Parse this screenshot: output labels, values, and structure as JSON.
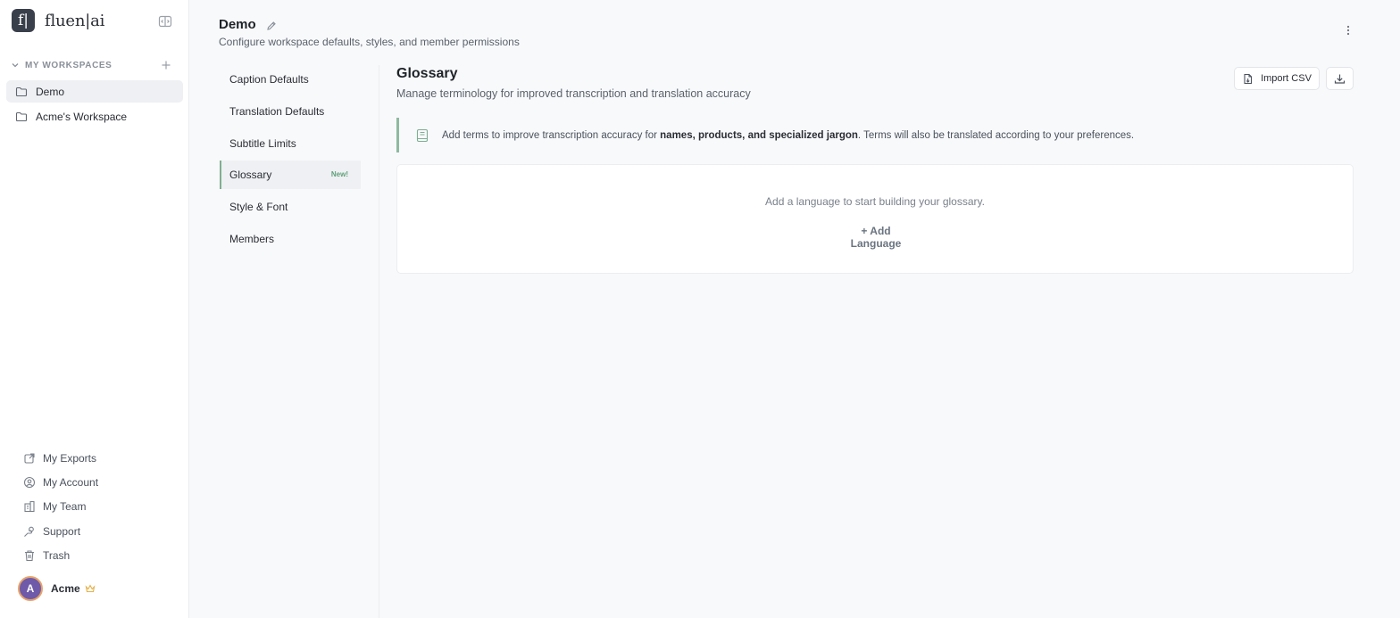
{
  "app": {
    "logo_letter": "f|",
    "logo_text": "fluen|ai"
  },
  "sidebar": {
    "workspaces_label": "MY WORKSPACES",
    "workspaces": [
      {
        "label": "Demo",
        "active": true
      },
      {
        "label": "Acme's Workspace",
        "active": false
      }
    ],
    "bottom_nav": [
      {
        "label": "My Exports",
        "icon": "exports-icon"
      },
      {
        "label": "My Account",
        "icon": "account-icon"
      },
      {
        "label": "My Team",
        "icon": "team-icon"
      },
      {
        "label": "Support",
        "icon": "support-icon"
      },
      {
        "label": "Trash",
        "icon": "trash-icon"
      }
    ],
    "user": {
      "initial": "A",
      "name": "Acme"
    }
  },
  "header": {
    "title": "Demo",
    "subtitle": "Configure workspace defaults, styles, and member permissions"
  },
  "settings_nav": {
    "items": [
      {
        "label": "Caption Defaults"
      },
      {
        "label": "Translation Defaults"
      },
      {
        "label": "Subtitle Limits"
      },
      {
        "label": "Glossary",
        "badge": "New!",
        "active": true
      },
      {
        "label": "Style & Font"
      },
      {
        "label": "Members"
      }
    ]
  },
  "glossary": {
    "title": "Glossary",
    "subtitle": "Manage terminology for improved transcription and translation accuracy",
    "import_label": "Import CSV",
    "info_prefix": "Add terms to improve transcription accuracy for ",
    "info_bold": "names, products, and specialized jargon",
    "info_suffix": ". Terms will also be translated according to your preferences.",
    "empty_text": "Add a language to start building your glossary.",
    "add_language_label": "+ Add Language"
  },
  "colors": {
    "accent_green": "#7fae92",
    "badge_green": "#5fa07a",
    "avatar_purple": "#6e5aa8",
    "avatar_ring": "#e7a46b"
  }
}
